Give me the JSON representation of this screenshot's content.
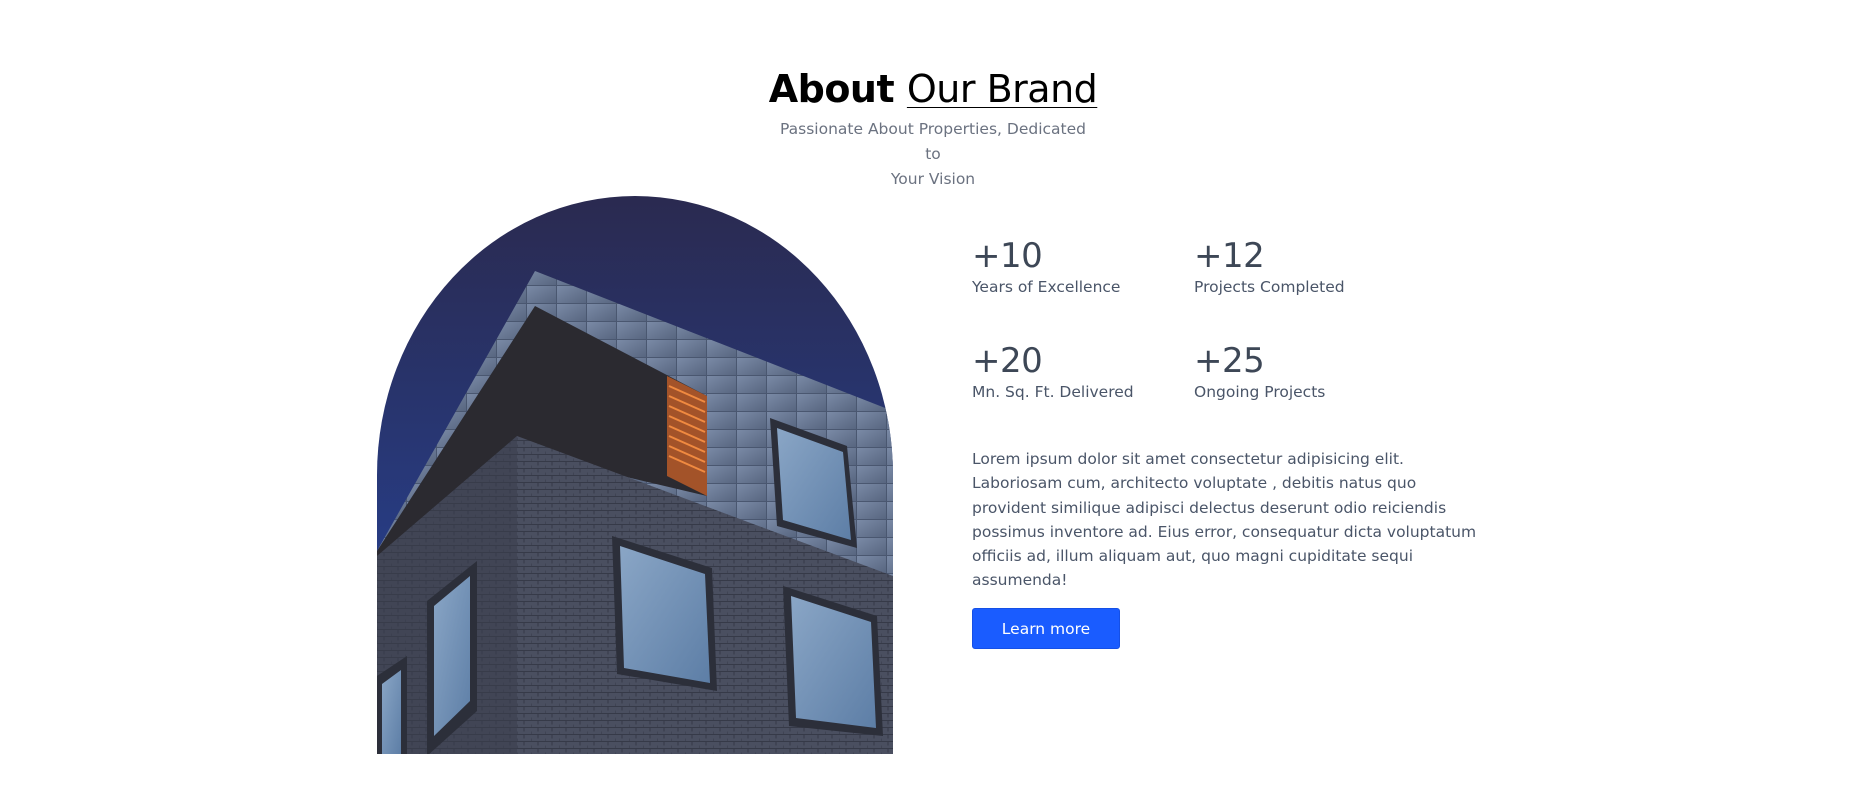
{
  "header": {
    "title_bold": "About",
    "title_light": "Our Brand",
    "subtitle_line1": "Passionate About Properties, Dedicated to",
    "subtitle_line2": "Your Vision"
  },
  "stats": [
    {
      "value": "+10",
      "label": "Years of Excellence"
    },
    {
      "value": "+12",
      "label": "Projects Completed"
    },
    {
      "value": "+20",
      "label": "Mn. Sq. Ft. Delivered"
    },
    {
      "value": "+25",
      "label": "Ongoing Projects"
    }
  ],
  "description": "Lorem ipsum dolor sit amet consectetur adipisicing elit. Laboriosam cum, architecto voluptate , debitis natus quo provident similique adipisci delectus deserunt odio reiciendis possimus inventore ad. Eius error, consequatur dicta voluptatum officiis ad, illum aliquam aut, quo magni cupiditate sequi assumenda!",
  "cta": {
    "label": "Learn more"
  },
  "colors": {
    "accent": "#1a5cff",
    "sky_top": "#2b2a52",
    "sky_bottom": "#2a4aa0",
    "text": "#4a5568"
  }
}
